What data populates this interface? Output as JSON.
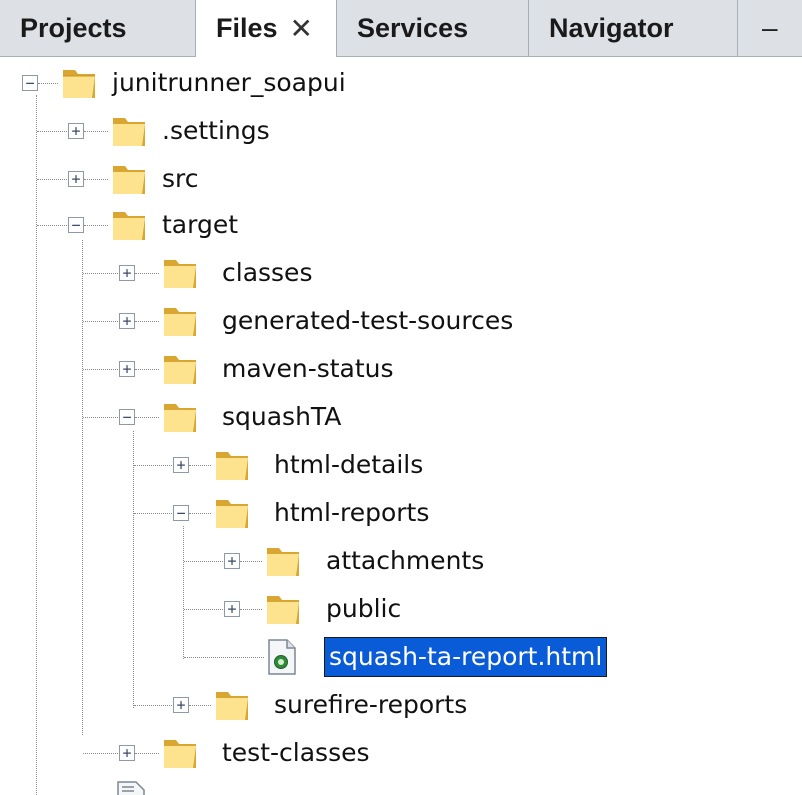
{
  "tabs": [
    {
      "label": "Projects"
    },
    {
      "label": "Files",
      "active": true,
      "close_glyph": "✕"
    },
    {
      "label": "Services"
    },
    {
      "label": "Navigator"
    }
  ],
  "tab_minimize_glyph": "–",
  "tree": {
    "root": {
      "label": "junitrunner_soapui"
    },
    "settings": {
      "label": ".settings"
    },
    "src": {
      "label": "src"
    },
    "target": {
      "label": "target"
    },
    "classes": {
      "label": "classes"
    },
    "generated_test_sources": {
      "label": "generated-test-sources"
    },
    "maven_status": {
      "label": "maven-status"
    },
    "squashta": {
      "label": "squashTA"
    },
    "html_details": {
      "label": "html-details"
    },
    "html_reports": {
      "label": "html-reports"
    },
    "attachments": {
      "label": "attachments"
    },
    "public": {
      "label": "public"
    },
    "report_file": {
      "label": "squash-ta-report.html",
      "selected": true
    },
    "surefire_reports": {
      "label": "surefire-reports"
    },
    "test_classes": {
      "label": "test-classes"
    }
  },
  "toggle_glyphs": {
    "collapsed": "+",
    "expanded": "−"
  },
  "icons": {
    "folder": "folder-icon",
    "html_file": "html-file-icon"
  },
  "colors": {
    "selection": "#0a5bd8",
    "folder_light": "#fde38e",
    "folder_dark": "#d9a631",
    "tabbar": "#dde1e6"
  }
}
